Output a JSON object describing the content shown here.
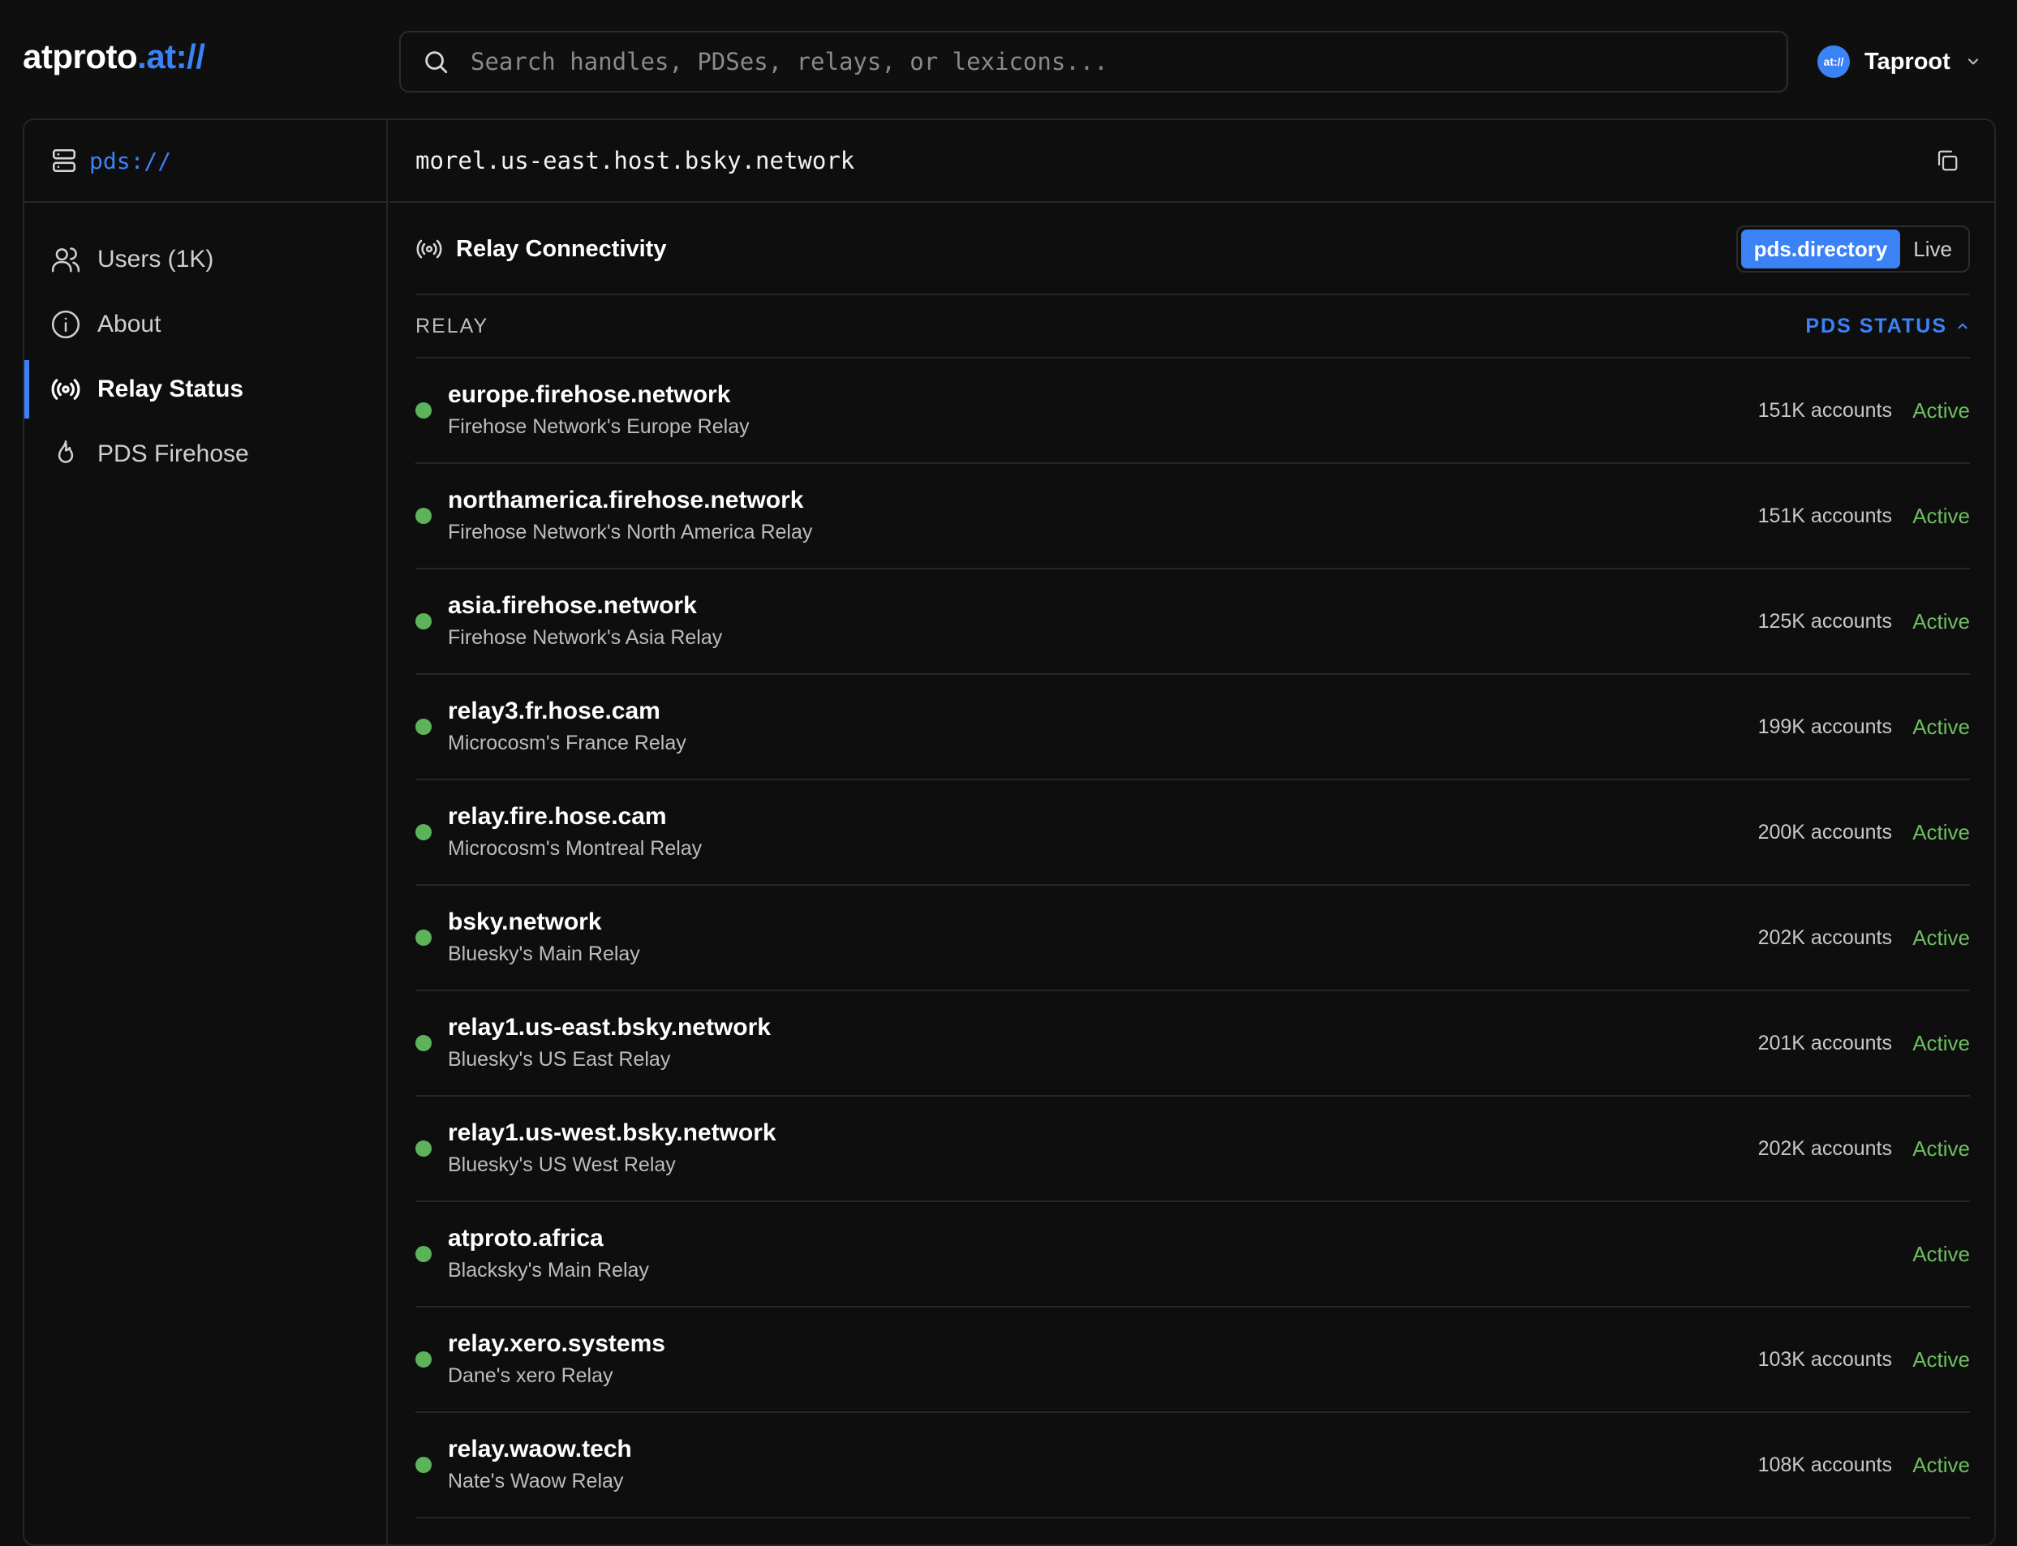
{
  "header": {
    "logo_main": "atproto",
    "logo_accent": ".at://",
    "search_placeholder": "Search handles, PDSes, relays, or lexicons...",
    "account_avatar_text": "at://",
    "account_name": "Taproot"
  },
  "sidebar": {
    "title": "pds://",
    "items": [
      {
        "label": "Users (1K)",
        "icon": "users-icon"
      },
      {
        "label": "About",
        "icon": "info-icon"
      },
      {
        "label": "Relay Status",
        "icon": "broadcast-icon",
        "active": true
      },
      {
        "label": "PDS Firehose",
        "icon": "flame-icon"
      }
    ]
  },
  "main": {
    "host": "morel.us-east.host.bsky.network",
    "section_title": "Relay Connectivity",
    "toggle": {
      "options": [
        "pds.directory",
        "Live"
      ],
      "selected": "pds.directory"
    },
    "columns": {
      "relay": "RELAY",
      "status": "PDS STATUS"
    },
    "status_color": "#6cbf5f",
    "accent_color": "#3b82f6",
    "relays": [
      {
        "host": "europe.firehose.network",
        "desc": "Firehose Network's Europe Relay",
        "accounts": "151K accounts",
        "status": "Active"
      },
      {
        "host": "northamerica.firehose.network",
        "desc": "Firehose Network's North America Relay",
        "accounts": "151K accounts",
        "status": "Active"
      },
      {
        "host": "asia.firehose.network",
        "desc": "Firehose Network's Asia Relay",
        "accounts": "125K accounts",
        "status": "Active"
      },
      {
        "host": "relay3.fr.hose.cam",
        "desc": "Microcosm's France Relay",
        "accounts": "199K accounts",
        "status": "Active"
      },
      {
        "host": "relay.fire.hose.cam",
        "desc": "Microcosm's Montreal Relay",
        "accounts": "200K accounts",
        "status": "Active"
      },
      {
        "host": "bsky.network",
        "desc": "Bluesky's Main Relay",
        "accounts": "202K accounts",
        "status": "Active"
      },
      {
        "host": "relay1.us-east.bsky.network",
        "desc": "Bluesky's US East Relay",
        "accounts": "201K accounts",
        "status": "Active"
      },
      {
        "host": "relay1.us-west.bsky.network",
        "desc": "Bluesky's US West Relay",
        "accounts": "202K accounts",
        "status": "Active"
      },
      {
        "host": "atproto.africa",
        "desc": "Blacksky's Main Relay",
        "accounts": "",
        "status": "Active"
      },
      {
        "host": "relay.xero.systems",
        "desc": "Dane's xero Relay",
        "accounts": "103K accounts",
        "status": "Active"
      },
      {
        "host": "relay.waow.tech",
        "desc": "Nate's Waow Relay",
        "accounts": "108K accounts",
        "status": "Active"
      }
    ]
  }
}
